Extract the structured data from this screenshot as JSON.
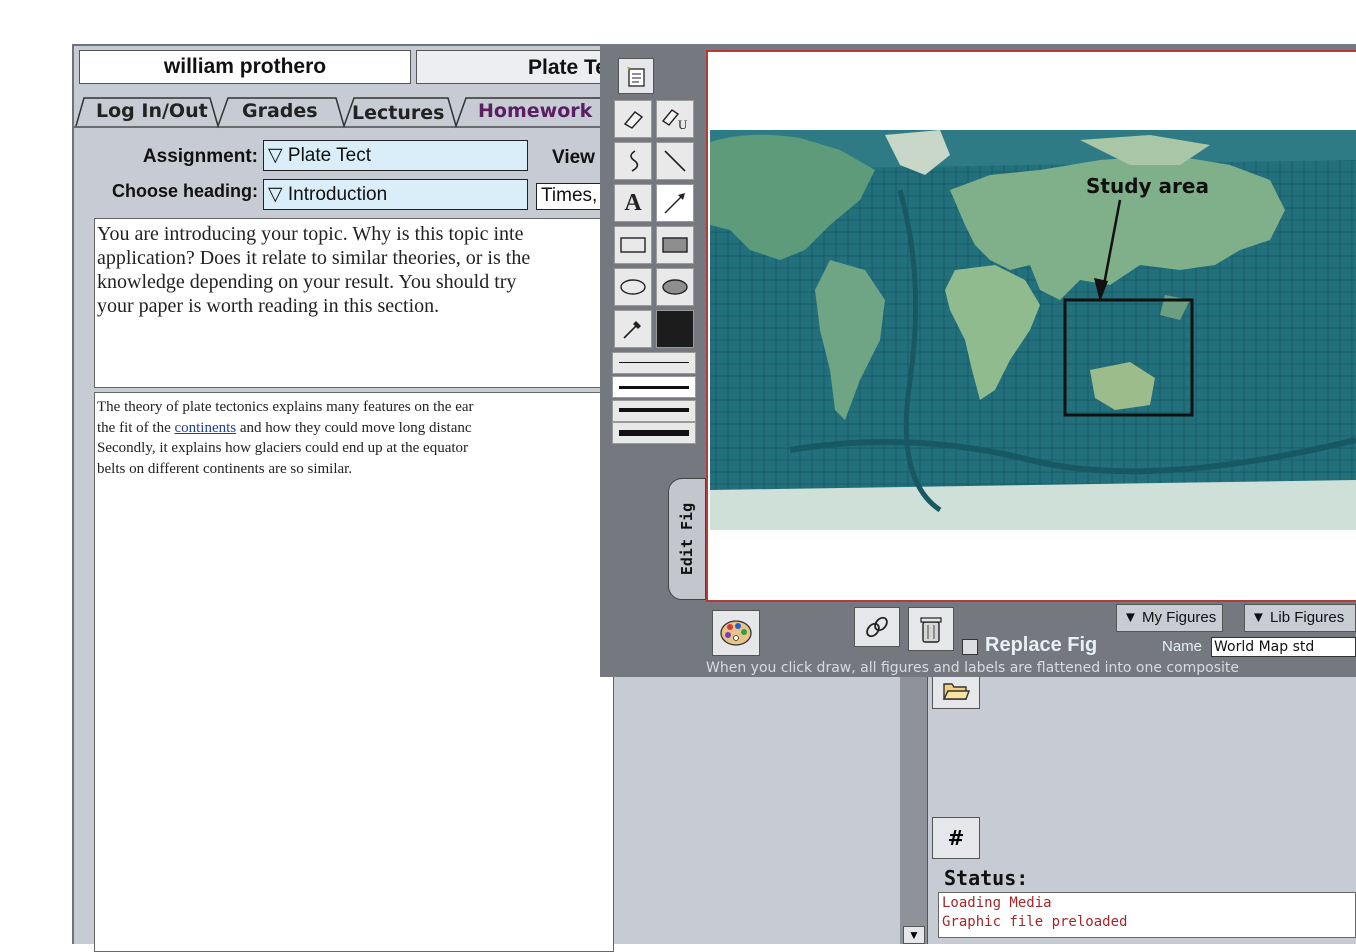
{
  "header": {
    "user_name": "william prothero",
    "doc_title": "Plate Te"
  },
  "tabs": [
    "Log In/Out",
    "Grades",
    "Lectures",
    "Homework"
  ],
  "assignment": {
    "label": "Assignment:",
    "value": "▽ Plate Tect",
    "view_label": "View"
  },
  "heading": {
    "label": "Choose heading:",
    "value": "▽ Introduction",
    "font_value": "Times,"
  },
  "instructions": [
    "You are introducing your topic. Why is this topic inte",
    "application? Does it relate to similar theories, or is the",
    "knowledge depending on your result. You should try",
    "your paper is worth reading in this section."
  ],
  "student_text": {
    "line1": "The theory of plate tectonics explains many features on the ear",
    "line2_pre": "the fit of the ",
    "line2_link": "continents",
    "line2_post": " and how they could move long distanc",
    "line3": "Secondly, it explains how glaciers could end up at  the equator",
    "line4": "belts on different continents are so similar."
  },
  "editor": {
    "edit_tab_label": "Edit Fig",
    "map_annotation": "Study area",
    "replace_label": "Replace Fig",
    "replace_checked": false,
    "my_figures_label": "▼ My Figures",
    "lib_figures_label": "▼ Lib Figures",
    "name_label": "Name",
    "name_value": "World  Map std",
    "footer_note": "When you click draw, all figures and labels are flattened into one composite",
    "fill_color": "#1c1c1c"
  },
  "right_panel": {
    "hash_label": "#",
    "status_label": "Status:",
    "status_lines": [
      "Loading Media",
      "Graphic file preloaded"
    ]
  },
  "colors": {
    "app_bg": "#c7cbd4",
    "field_bg": "#d9eef8",
    "homework_tab": "#5a1f63",
    "link": "#1e3f9c",
    "status_text": "#a3262a",
    "replace_text": "#e8f0f8",
    "footer_text": "#d8dce2"
  }
}
